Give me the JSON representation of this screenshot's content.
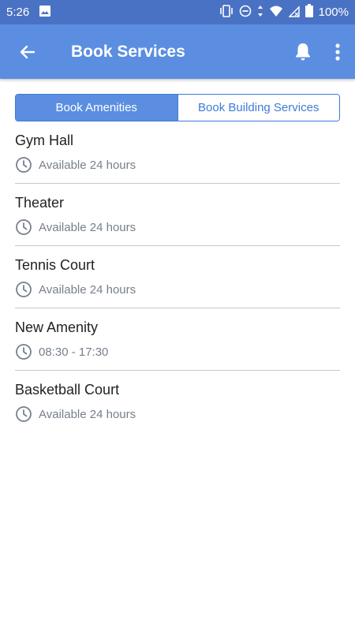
{
  "status": {
    "time": "5:26",
    "battery": "100%"
  },
  "header": {
    "title": "Book Services"
  },
  "tabs": [
    {
      "label": "Book Amenities",
      "active": true
    },
    {
      "label": "Book Building Services",
      "active": false
    }
  ],
  "amenities": [
    {
      "name": "Gym Hall",
      "hours": "Available 24 hours"
    },
    {
      "name": "Theater",
      "hours": "Available 24 hours"
    },
    {
      "name": "Tennis Court",
      "hours": "Available 24 hours"
    },
    {
      "name": "New Amenity",
      "hours": "08:30 - 17:30"
    },
    {
      "name": "Basketball Court",
      "hours": "Available 24 hours"
    }
  ],
  "colors": {
    "status_bar": "#4a72c4",
    "app_bar": "#5b8ee0",
    "accent": "#3f7bd8",
    "muted_text": "#777f8c"
  }
}
